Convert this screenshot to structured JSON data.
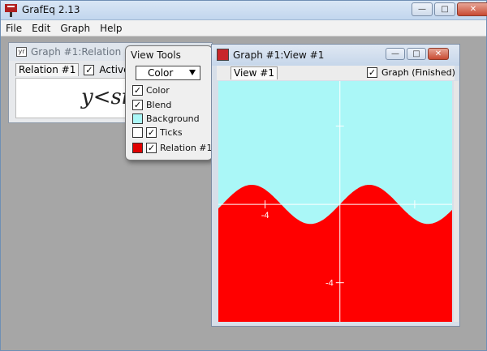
{
  "app": {
    "title": "GrafEq 2.13",
    "menu": [
      "File",
      "Edit",
      "Graph",
      "Help"
    ],
    "window_buttons": {
      "minimize": "—",
      "maximize": "□",
      "close": "✕"
    }
  },
  "relation_window": {
    "title": "Graph #1:Relation #1",
    "tab_label": "Relation #1",
    "active_label": "Active",
    "active_checked": true,
    "color_swatch": "#e00000",
    "expression": "y<si"
  },
  "view_tools": {
    "title": "View Tools",
    "mode_select": "Color",
    "rows": [
      {
        "label": "Color",
        "checked": true
      },
      {
        "label": "Blend",
        "checked": true
      },
      {
        "label": "Background",
        "swatch": "#aaf7f7"
      },
      {
        "label": "Ticks",
        "checked": true,
        "swatch": "#ffffff"
      },
      {
        "label": "Relation #1",
        "checked": true,
        "swatch": "#e00000"
      }
    ]
  },
  "view_window": {
    "title": "Graph #1:View #1",
    "tab_label": "View #1",
    "status_label": "Graph (Finished)",
    "status_checked": true
  },
  "chart_data": {
    "type": "area",
    "description_of_relation": "region y < sin(x) shaded",
    "x_range": [
      -6.5,
      6.0
    ],
    "y_range": [
      -6.0,
      6.3
    ],
    "xtick_labels": [
      {
        "x": -4,
        "label": "-4"
      }
    ],
    "ytick_labels": [
      {
        "y": -4,
        "label": "-4"
      }
    ],
    "background_color": "#aaf7f7",
    "fill_color": "#ff0000",
    "axis_color": "#ffffff",
    "curve": "sin"
  }
}
